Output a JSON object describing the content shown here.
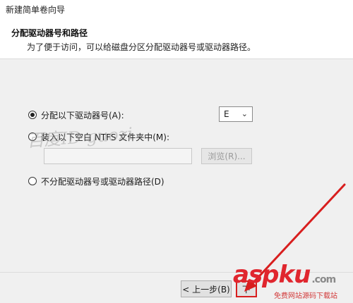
{
  "window": {
    "title": "新建简单卷向导"
  },
  "header": {
    "title": "分配驱动器号和路径",
    "subtitle": "为了便于访问，可以给磁盘分区分配驱动器号或驱动器路径。"
  },
  "options": {
    "assign_letter": {
      "label": "分配以下驱动器号(A):",
      "selected": true
    },
    "mount_folder": {
      "label": "装入以下空白 NTFS 文件夹中(M):",
      "selected": false
    },
    "no_assign": {
      "label": "不分配驱动器号或驱动器路径(D)",
      "selected": false
    }
  },
  "drive_letter": {
    "value": "E"
  },
  "folder_path": {
    "value": ""
  },
  "browse_label": "浏览(R)...",
  "buttons": {
    "back": "< 上一步(B)",
    "next": "下"
  },
  "watermark": {
    "text": "百度ID guozi"
  },
  "brand": {
    "name": "aspku",
    "tld": ".com",
    "tagline": "免费网站源码下载站"
  },
  "colors": {
    "highlight": "#d81e1e",
    "brand": "#e0262e"
  }
}
